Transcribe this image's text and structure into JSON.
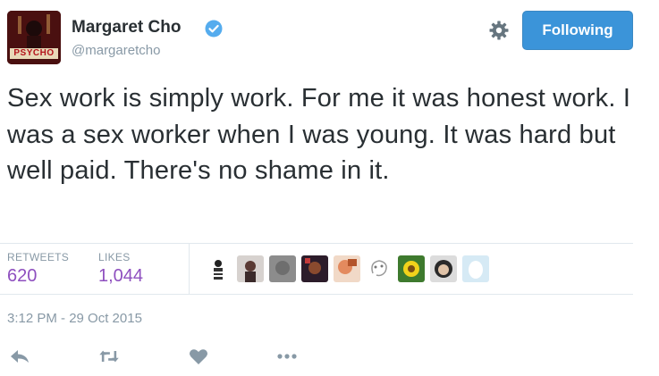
{
  "author": {
    "name": "Margaret Cho",
    "handle": "@margaretcho",
    "avatar_text": "PSYCHO",
    "verified": true
  },
  "follow_button": {
    "label": "Following",
    "color": "#3b94d9"
  },
  "tweet": {
    "text": "Sex work is simply work. For me it was honest work. I was a sex worker when I was young. It was hard but well paid. There's no shame in it."
  },
  "stats": {
    "retweets_label": "RETWEETS",
    "retweets": "620",
    "likes_label": "LIKES",
    "likes": "1,044"
  },
  "liked_by_count": 10,
  "timestamp": "3:12 PM - 29 Oct 2015",
  "actions": [
    "reply-icon",
    "retweet-icon",
    "like-icon",
    "more-icon"
  ],
  "colors": {
    "stat_value": "#8e4fbf",
    "muted": "#8899a6",
    "accent": "#3b94d9"
  }
}
